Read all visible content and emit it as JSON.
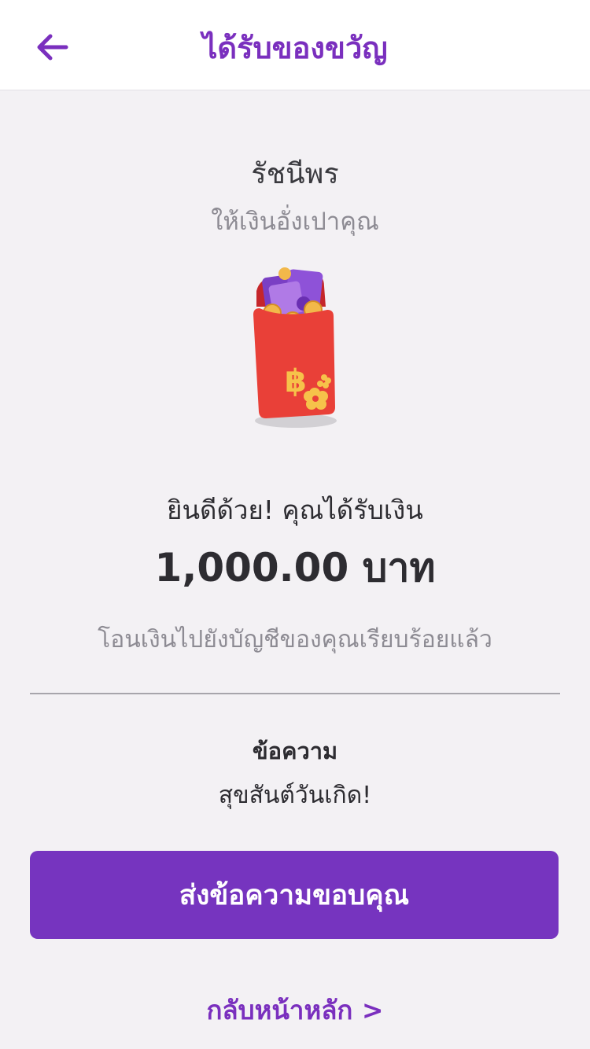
{
  "header": {
    "title": "ได้รับของขวัญ",
    "back_icon": "arrow-left-icon",
    "accent": "#7a2fbe"
  },
  "sender": {
    "name": "รัชนีพร",
    "subtitle": "ให้เงินอั่งเปาคุณ"
  },
  "envelope": {
    "icon": "red-envelope-icon",
    "symbol": "฿"
  },
  "result": {
    "congrats": "ยินดีด้วย! คุณได้รับเงิน",
    "amount": "1,000.00 บาท",
    "transfer_note": "โอนเงินไปยังบัญชีของคุณเรียบร้อยแล้ว"
  },
  "message": {
    "label": "ข้อความ",
    "text": "สุขสันต์วันเกิด!"
  },
  "actions": {
    "thank_button": "ส่งข้อความขอบคุณ",
    "home_link": "กลับหน้าหลัก >",
    "button_color": "#7634bf"
  }
}
